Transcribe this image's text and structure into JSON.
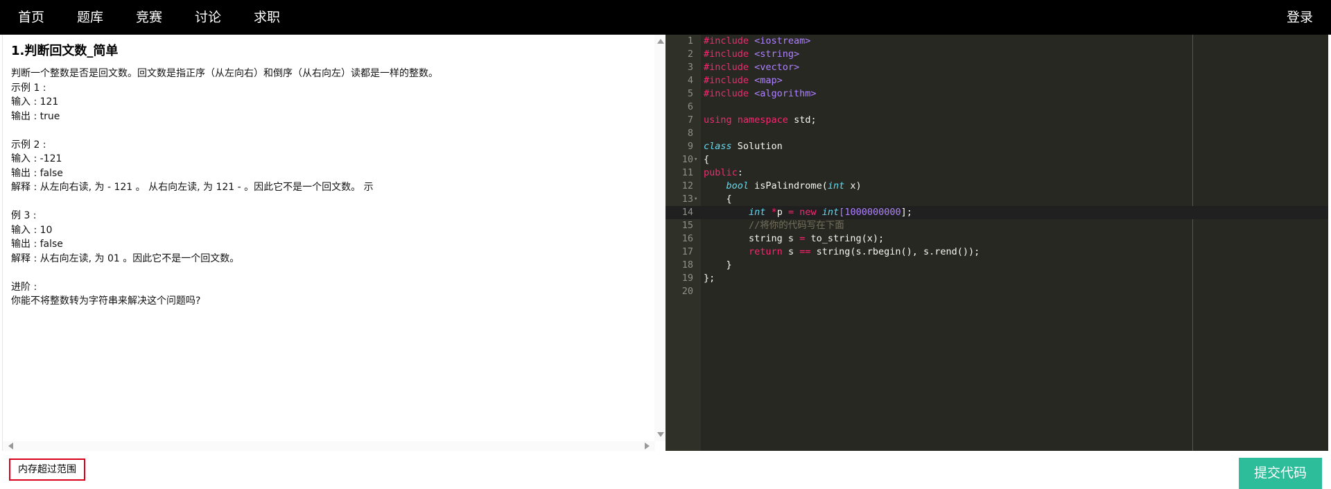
{
  "nav": {
    "home": "首页",
    "bank": "题库",
    "contest": "竞赛",
    "discuss": "讨论",
    "job": "求职",
    "login": "登录"
  },
  "problem": {
    "title": "1.判断回文数_简单",
    "lines": [
      "判断一个整数是否是回文数。回文数是指正序（从左向右）和倒序（从右向左）读都是一样的整数。",
      "示例 1 :",
      "输入 : 121",
      "输出 : true",
      "",
      "示例 2 :",
      "输入 : -121",
      "输出 : false",
      "解释 : 从左向右读, 为 - 121 。 从右向左读, 为 121 - 。因此它不是一个回文数。 示",
      "",
      "例 3 :",
      "输入 : 10",
      "输出 : false",
      "解释 : 从右向左读, 为 01 。因此它不是一个回文数。",
      "",
      "进阶 :",
      "你能不将整数转为字符串来解决这个问题吗?"
    ]
  },
  "editor": {
    "line_numbers": [
      "1",
      "2",
      "3",
      "4",
      "5",
      "6",
      "7",
      "8",
      "9",
      "10",
      "11",
      "12",
      "13",
      "14",
      "15",
      "16",
      "17",
      "18",
      "19",
      "20"
    ],
    "fold_markers": {
      "10": "▾",
      "13": "▾"
    },
    "active_line": 14,
    "code": {
      "l1_kw": "#include",
      "l1_rest": " <iostream>",
      "l2_kw": "#include",
      "l2_rest": " <string>",
      "l3_kw": "#include",
      "l3_rest": " <vector>",
      "l4_kw": "#include",
      "l4_rest": " <map>",
      "l5_kw": "#include",
      "l5_rest": " <algorithm>",
      "l7_kw1": "using",
      "l7_kw2": "namespace",
      "l7_rest": " std;",
      "l9_kw": "class",
      "l9_rest": " Solution",
      "l10": "{",
      "l11_kw": "public",
      "l11_rest": ":",
      "l12_indent": "    ",
      "l12_type": "bool",
      "l12_name": " isPalindrome(",
      "l12_type2": "int",
      "l12_rest": " x)",
      "l13": "    {",
      "l14_indent": "        ",
      "l14_type": "int",
      "l14_sp": " ",
      "l14_op": "*",
      "l14_p": "p ",
      "l14_eq": "=",
      "l14_sp2": " ",
      "l14_new": "new",
      "l14_sp3": " ",
      "l14_type2": "int",
      "l14_br": "[",
      "l14_num": "1000000000",
      "l14_end": "];",
      "l15_indent": "        ",
      "l15_cmt": "//将你的代码写在下面",
      "l16_indent": "        ",
      "l16_a": "string s ",
      "l16_eq": "=",
      "l16_b": " to_string(x);",
      "l17_indent": "        ",
      "l17_ret": "return",
      "l17_a": " s ",
      "l17_eq": "==",
      "l17_b": " string(s.rbegin(), s.rend());",
      "l18": "    }",
      "l19": "};"
    }
  },
  "status": {
    "message": "内存超过范围",
    "color": "#d9001b"
  },
  "submit": {
    "label": "提交代码",
    "color": "#2dbd9a"
  }
}
